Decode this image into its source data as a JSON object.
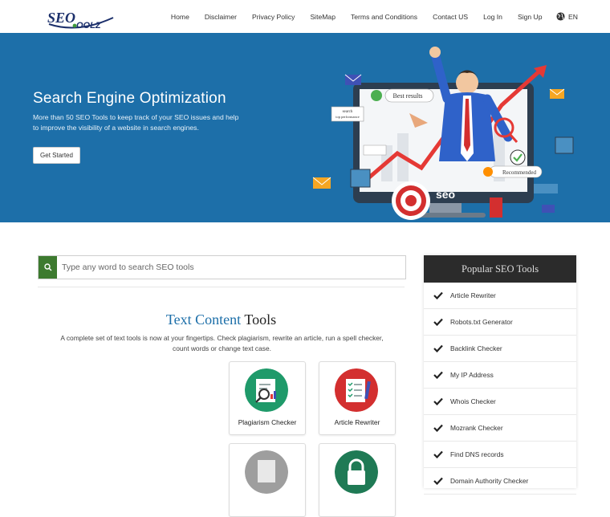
{
  "brand": {
    "logo_text": "SEOTOOLZ"
  },
  "nav": {
    "items": [
      "Home",
      "Disclaimer",
      "Privacy Policy",
      "SiteMap",
      "Terms and Conditions",
      "Contact US",
      "Log In",
      "Sign Up"
    ],
    "language": "EN"
  },
  "hero": {
    "title": "Search Engine Optimization",
    "text": "More than 50 SEO Tools to keep track of your SEO issues and help to improve the visibility of a website in search engines.",
    "button": "Get Started",
    "art_labels": {
      "best_results": "Best results",
      "recommended": "Recommended",
      "seo": "seo",
      "search": "search",
      "top_performance": "top performance"
    }
  },
  "search": {
    "placeholder": "Type any word to search SEO tools"
  },
  "section": {
    "title_part1": "Text Content",
    "title_part2": "Tools",
    "description": "A complete set of text tools is now at your fingertips. Check plagiarism, rewrite an article, run a spell checker, count words or change text case."
  },
  "cards": [
    {
      "label": "Plagiarism Checker",
      "color": "#1f9a6a"
    },
    {
      "label": "Article Rewriter",
      "color": "#d32f2f"
    },
    {
      "label": "",
      "color": "#9e9e9e"
    },
    {
      "label": "",
      "color": "#1f7a55"
    }
  ],
  "sidebar": {
    "title": "Popular SEO Tools",
    "items": [
      "Article Rewriter",
      "Robots.txt Generator",
      "Backlink Checker",
      "My IP Address",
      "Whois Checker",
      "Mozrank Checker",
      "Find DNS records",
      "Domain Authority Checker"
    ]
  },
  "colors": {
    "hero_bg": "#1d6fa9",
    "accent_blue": "#1d6fa9",
    "search_button": "#3d7a2f",
    "sidebar_header": "#2b2b2b"
  },
  "icons": {
    "search": "search-icon",
    "globe": "globe-icon",
    "check": "check-icon"
  }
}
